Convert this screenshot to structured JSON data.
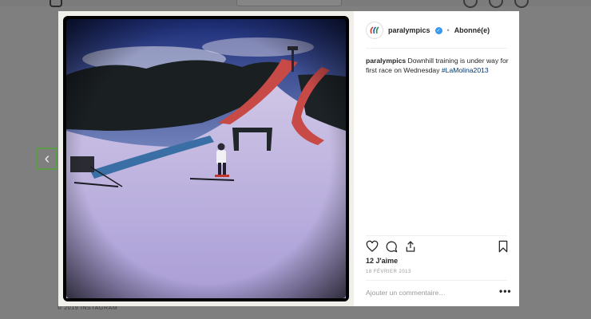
{
  "footer": {
    "copyright": "© 2019 INSTAGRAM"
  },
  "nav": {
    "prev_icon": "chevron-left-icon"
  },
  "post": {
    "username": "paralympics",
    "verified_icon": "verified-badge-icon",
    "separator": "•",
    "follow_status": "Abonné(e)",
    "caption_user": "paralympics",
    "caption_text": " Downhill training is under way for first race on Wednesday ",
    "caption_hashtag": "#LaMolina2013",
    "likes": "12 J'aime",
    "date": "18 FÉVRIER 2013",
    "comment_placeholder": "Ajouter un commentaire…",
    "more_options": "•••",
    "icons": [
      "heart-icon",
      "comment-icon",
      "share-icon",
      "bookmark-icon"
    ]
  },
  "colors": {
    "accent_link": "#003569",
    "verified": "#3897f0",
    "backdrop": "#7f7f7f"
  }
}
